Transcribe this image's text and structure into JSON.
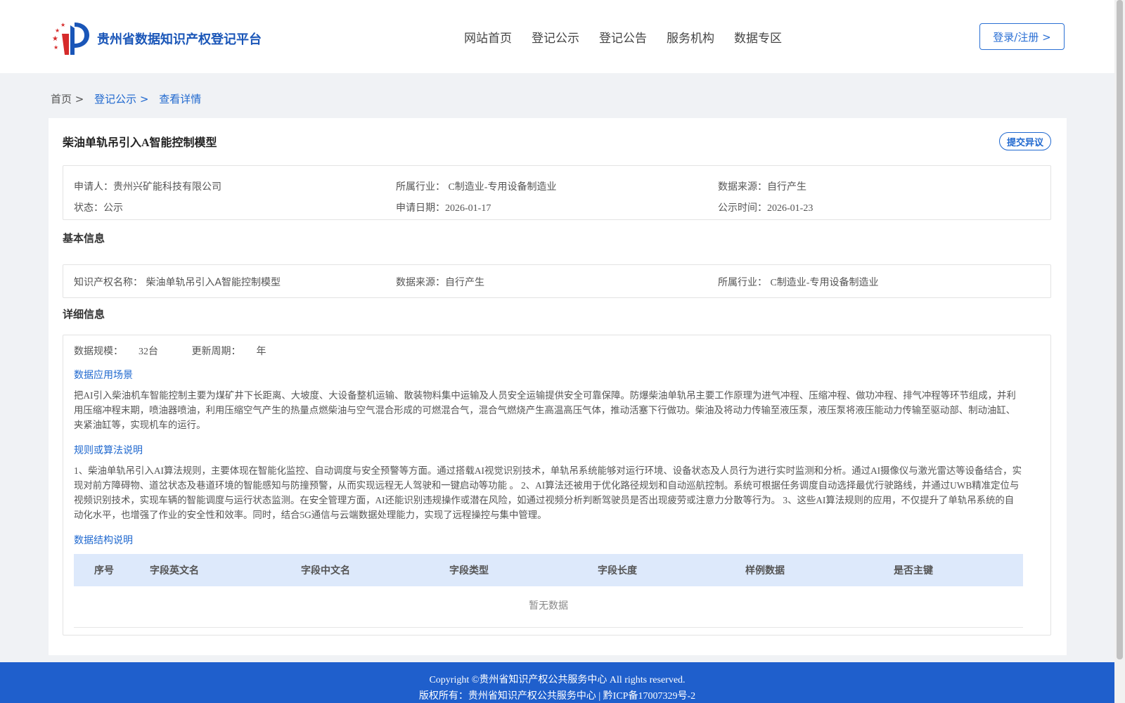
{
  "header": {
    "site_title": "贵州省数据知识产权登记平台",
    "nav": [
      "网站首页",
      "登记公示",
      "登记公告",
      "服务机构",
      "数据专区"
    ],
    "login_label": "登录/注册 >"
  },
  "breadcrumb": {
    "home": "首页 >",
    "section": "登记公示 >",
    "current": "查看详情"
  },
  "record": {
    "title": "柴油单轨吊引入A智能控制模型",
    "objection_label": "提交异议",
    "meta": {
      "applicant_label": "申请人：",
      "applicant": "贵州兴矿能科技有限公司",
      "industry_label": "所属行业：",
      "industry": "C制造业-专用设备制造业",
      "source_label": "数据来源：",
      "source": "自行产生",
      "status_label": "状态：",
      "status": "公示",
      "apply_date_label": "申请日期：",
      "apply_date": "2026-01-17",
      "publish_date_label": "公示时间：",
      "publish_date": "2026-01-23"
    }
  },
  "basic": {
    "section_title": "基本信息",
    "ip_name_label": "知识产权名称：",
    "ip_name": "柴油单轨吊引入A智能控制模型",
    "source_label": "数据来源：",
    "source": "自行产生",
    "industry_label": "所属行业：",
    "industry": "C制造业-专用设备制造业"
  },
  "detail": {
    "section_title": "详细信息",
    "scale_label": "数据规模：",
    "scale": "32台",
    "cycle_label": "更新周期：",
    "cycle": "年",
    "scene_title": "数据应用场景",
    "scene_text": "把AI引入柴油机车智能控制主要为煤矿井下长距离、大坡度、大设备整机运输、散装物料集中运输及人员安全运输提供安全可靠保障。防爆柴油单轨吊主要工作原理为进气冲程、压缩冲程、做功冲程、排气冲程等环节组成，并利用压缩冲程末期，喷油器喷油，利用压缩空气产生的热量点燃柴油与空气混合形成的可燃混合气，混合气燃烧产生高温高压气体，推动活塞下行做功。柴油及将动力传输至液压泵，液压泵将液压能动力传输至驱动部、制动油缸、夹紧油缸等，实现机车的运行。",
    "algo_title": "规则或算法说明",
    "algo_text": "1、柴油单轨吊引入AI算法规则，主要体现在智能化监控、自动调度与安全预警等方面。通过搭载AI视觉识别技术，单轨吊系统能够对运行环境、设备状态及人员行为进行实时监测和分析。通过AI摄像仪与激光雷达等设备结合，实现对前方障碍物、道岔状态及巷道环境的智能感知与防撞预警，从而实现远程无人驾驶和一键启动等功能 。 2、AI算法还被用于优化路径规划和自动巡航控制。系统可根据任务调度自动选择最优行驶路线，并通过UWB精准定位与视频识别技术，实现车辆的智能调度与运行状态监测。在安全管理方面，AI还能识别违规操作或潜在风险，如通过视频分析判断驾驶员是否出现疲劳或注意力分散等行为。 3、这些AI算法规则的应用，不仅提升了单轨吊系统的自动化水平，也增强了作业的安全性和效率。同时，结合5G通信与云端数据处理能力，实现了远程操控与集中管理。",
    "struct_title": "数据结构说明",
    "table_headers": [
      "序号",
      "字段英文名",
      "字段中文名",
      "字段类型",
      "字段长度",
      "样例数据",
      "是否主键"
    ],
    "empty_text": "暂无数据"
  },
  "footer": {
    "line1": "Copyright ©贵州省知识产权公共服务中心 All rights reserved.",
    "line2": "版权所有：贵州省知识产权公共服务中心 | 黔ICP备17007329号-2"
  },
  "colors": {
    "brand": "#1f68cf",
    "footer_bg": "#1f5fcc",
    "table_head_bg": "#dde9fb"
  }
}
